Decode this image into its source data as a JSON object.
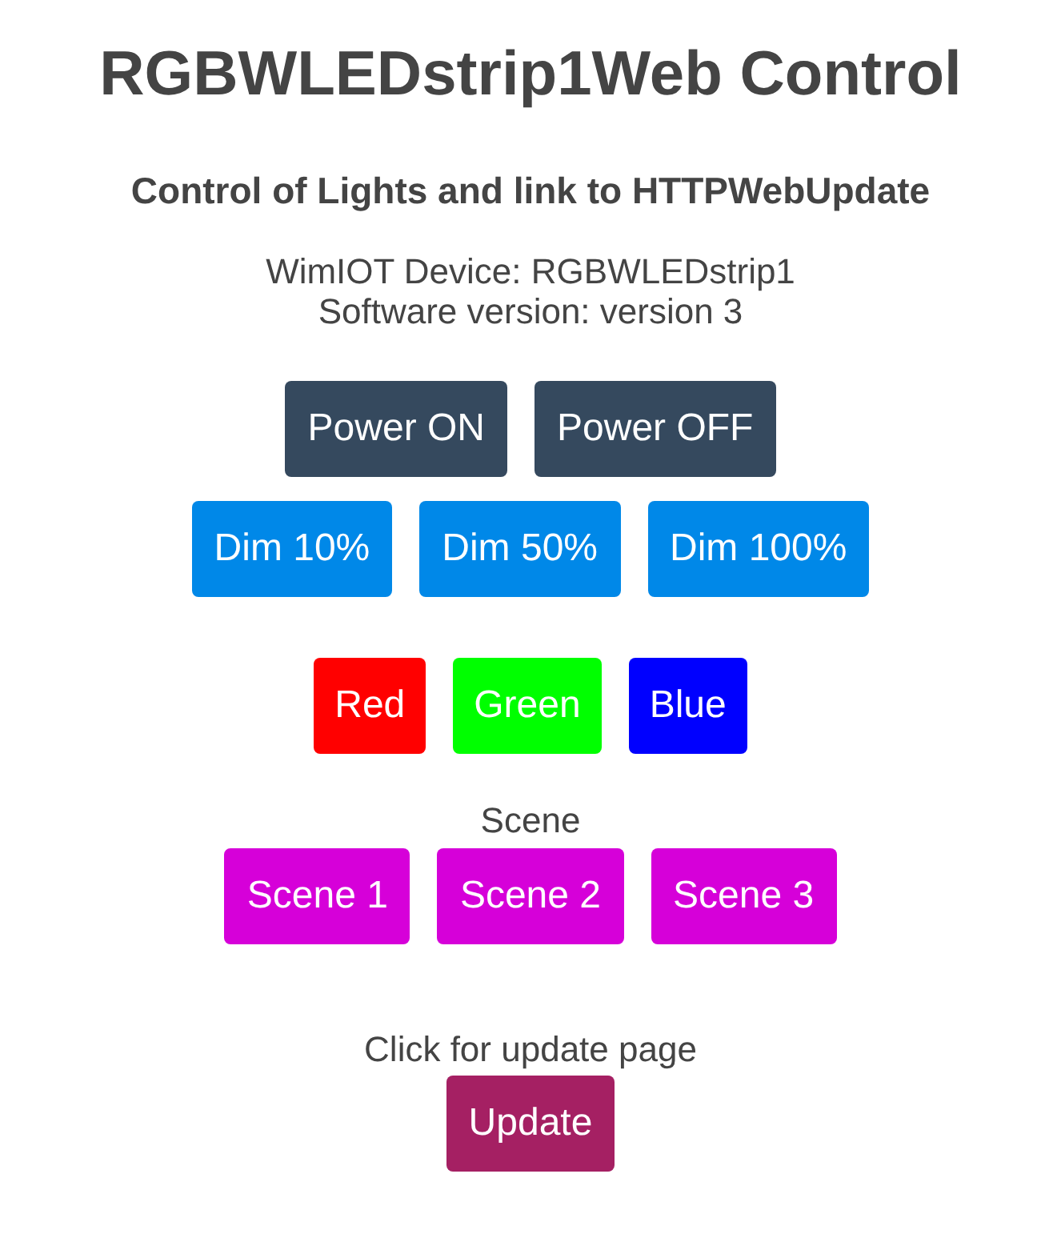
{
  "title": "RGBWLEDstrip1Web Control",
  "subtitle": "Control of Lights and link to HTTPWebUpdate",
  "device_info": [
    "WimIOT Device: RGBWLEDstrip1",
    "Software version: version 3"
  ],
  "sections": [
    {
      "kind": "power",
      "buttons": [
        {
          "label": "Power ON"
        },
        {
          "label": "Power OFF"
        }
      ]
    },
    {
      "kind": "dim",
      "buttons": [
        {
          "label": "Dim 10%"
        },
        {
          "label": "Dim 50%"
        },
        {
          "label": "Dim 100%"
        }
      ]
    },
    {
      "kind": "color",
      "buttons": [
        {
          "label": "Red",
          "color": "#ff0000"
        },
        {
          "label": "Green",
          "color": "#00ff00"
        },
        {
          "label": "Blue",
          "color": "#0000ff"
        }
      ]
    },
    {
      "kind": "scene",
      "heading": "Scene",
      "buttons": [
        {
          "label": "Scene 1"
        },
        {
          "label": "Scene 2"
        },
        {
          "label": "Scene 3"
        }
      ]
    },
    {
      "kind": "update",
      "heading": "Click for update page",
      "buttons": [
        {
          "label": "Update"
        }
      ]
    }
  ]
}
